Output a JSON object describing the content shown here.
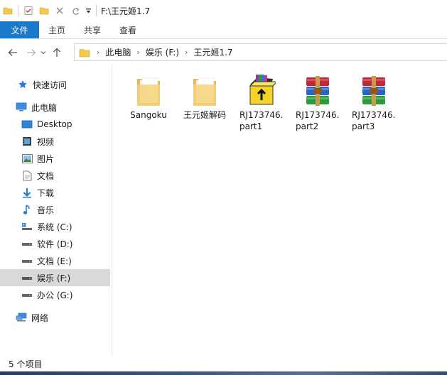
{
  "window": {
    "title": "F:\\王元姬1.7"
  },
  "ribbon": {
    "tabs": [
      {
        "label": "文件"
      },
      {
        "label": "主页"
      },
      {
        "label": "共享"
      },
      {
        "label": "查看"
      }
    ]
  },
  "address": {
    "breadcrumbs": [
      "此电脑",
      "娱乐 (F:)",
      "王元姬1.7"
    ]
  },
  "nav": {
    "items": [
      {
        "label": "快速访问",
        "icon": "star-icon"
      },
      {
        "label": "此电脑",
        "icon": "computer-icon"
      },
      {
        "label": "Desktop",
        "icon": "desktop-icon"
      },
      {
        "label": "视频",
        "icon": "video-icon"
      },
      {
        "label": "图片",
        "icon": "picture-icon"
      },
      {
        "label": "文档",
        "icon": "document-icon"
      },
      {
        "label": "下载",
        "icon": "download-icon"
      },
      {
        "label": "音乐",
        "icon": "music-icon"
      },
      {
        "label": "系统 (C:)",
        "icon": "system-drive-icon"
      },
      {
        "label": "软件 (D:)",
        "icon": "drive-icon"
      },
      {
        "label": "文档 (E:)",
        "icon": "drive-icon"
      },
      {
        "label": "娱乐 (F:)",
        "icon": "drive-icon",
        "selected": true
      },
      {
        "label": "办公 (G:)",
        "icon": "drive-icon"
      },
      {
        "label": "网络",
        "icon": "network-icon"
      }
    ]
  },
  "files": [
    {
      "name": "Sangoku",
      "icon": "folder-icon"
    },
    {
      "name": "王元姬解码",
      "icon": "folder-icon"
    },
    {
      "name": "RJ173746.part1",
      "line1": "RJ173746.",
      "line2": "part1",
      "icon": "winrar-sfx-icon"
    },
    {
      "name": "RJ173746.part2",
      "line1": "RJ173746.",
      "line2": "part2",
      "icon": "winrar-archive-icon"
    },
    {
      "name": "RJ173746.part3",
      "line1": "RJ173746.",
      "line2": "part3",
      "icon": "winrar-archive-icon"
    }
  ],
  "status": {
    "text": "5 个项目"
  },
  "colors": {
    "accent": "#1979ca",
    "selected": "#d9d9d9",
    "folder": "#f2c94c"
  }
}
